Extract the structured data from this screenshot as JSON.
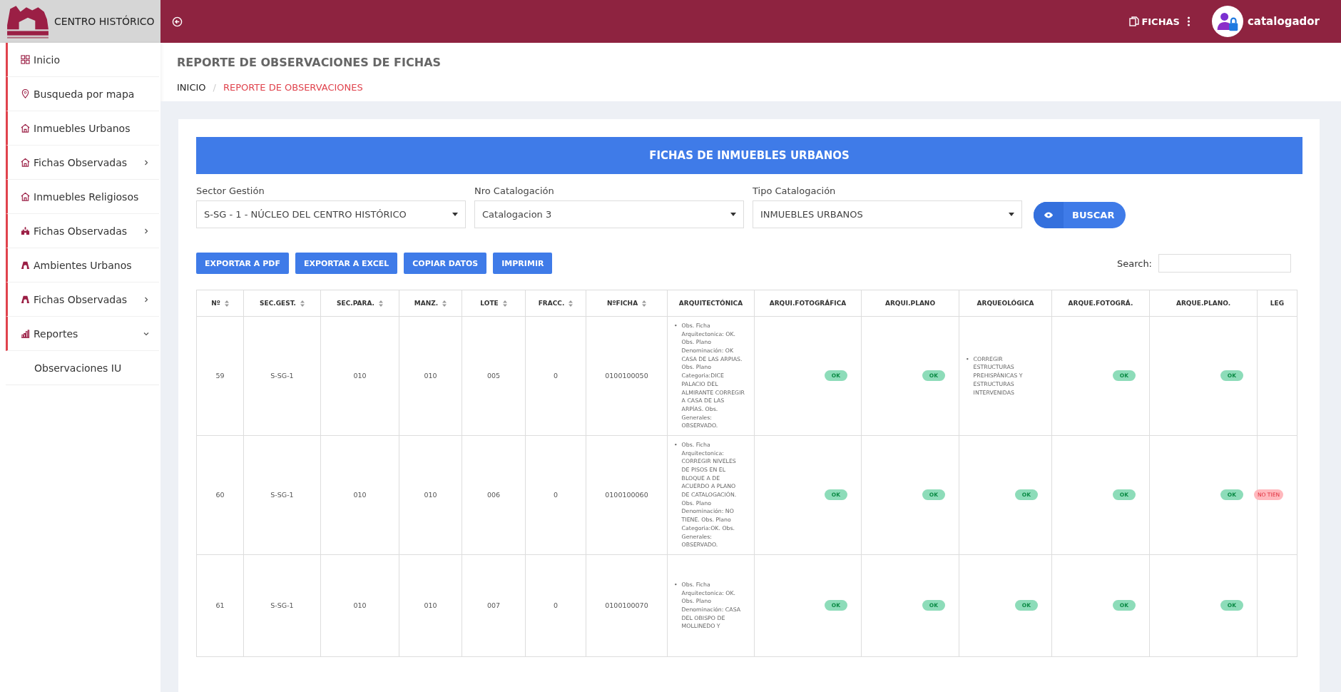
{
  "brand": {
    "title": "CENTRO HISTÓRICO"
  },
  "topbar": {
    "menu_label": "FICHAS",
    "user": "catalogador"
  },
  "sidebar": {
    "items": [
      {
        "kind": "grid",
        "label": "Inicio"
      },
      {
        "kind": "pin",
        "label": "Busqueda por mapa"
      },
      {
        "kind": "house",
        "label": "Inmuebles Urbanos"
      },
      {
        "kind": "house",
        "label": "Fichas Observadas",
        "expanded": false
      },
      {
        "kind": "house",
        "label": "Inmuebles Religiosos"
      },
      {
        "kind": "castle",
        "label": "Fichas Observadas",
        "expanded": false
      },
      {
        "kind": "gate",
        "label": "Ambientes Urbanos"
      },
      {
        "kind": "gate",
        "label": "Fichas Observadas",
        "expanded": false
      },
      {
        "kind": "chart",
        "label": "Reportes",
        "expanded": true,
        "children": [
          {
            "label": "Observaciones IU"
          }
        ]
      }
    ]
  },
  "page": {
    "title": "REPORTE DE OBSERVACIONES DE FICHAS",
    "breadcrumb": [
      "INICIO",
      "REPORTE DE OBSERVACIONES"
    ],
    "breadcrumb_separator": "/"
  },
  "card": {
    "banner": "FICHAS DE INMUEBLES URBANOS",
    "filters": [
      {
        "label": "Sector Gestión",
        "value": "S-SG - 1 - NÚCLEO DEL CENTRO HISTÓRICO"
      },
      {
        "label": "Nro Catalogación",
        "value": "Catalogacion 3"
      },
      {
        "label": "Tipo Catalogación",
        "value": "INMUEBLES URBANOS"
      }
    ],
    "search_button": "BUSCAR",
    "export_buttons": [
      "EXPORTAR A PDF",
      "EXPORTAR A EXCEL",
      "COPIAR DATOS",
      "IMPRIMIR"
    ],
    "search": {
      "label": "Search:"
    },
    "table": {
      "columns": [
        {
          "label": "Nº",
          "sortable": true
        },
        {
          "label": "SEC.GEST.",
          "sortable": true
        },
        {
          "label": "SEC.PARA.",
          "sortable": true
        },
        {
          "label": "MANZ.",
          "sortable": true
        },
        {
          "label": "LOTE",
          "sortable": true
        },
        {
          "label": "FRACC.",
          "sortable": true
        },
        {
          "label": "NºFICHA",
          "sortable": true
        },
        {
          "label": "ARQUITECTÓNICA",
          "sortable": false
        },
        {
          "label": "ARQUI.FOTOGRÁFICA",
          "sortable": false
        },
        {
          "label": "ARQUI.PLANO",
          "sortable": false
        },
        {
          "label": "ARQUEOLÓGICA",
          "sortable": false
        },
        {
          "label": "ARQUE.FOTOGRÁ.",
          "sortable": false
        },
        {
          "label": "ARQUE.PLANO.",
          "sortable": false
        },
        {
          "label": "LEG",
          "sortable": false
        }
      ],
      "rows": [
        {
          "cells": [
            "59",
            "S-SG-1",
            "010",
            "010",
            "005",
            "0",
            "0100100050"
          ],
          "reviews": [
            {
              "kind": "list",
              "marker": "•",
              "items": [
                "Obs. Ficha Arquitectonica: OK. Obs. Plano Denominación: OK CASA DE LAS ARPIAS. Obs. Plano Categoria:DICE PALACIO DEL ALMIRANTE CORREGIR A CASA DE LAS ARPÍAS. Obs. Generales: OBSERVADO."
              ]
            },
            {
              "kind": "ok",
              "text": "OK"
            },
            {
              "kind": "ok",
              "text": "OK"
            },
            {
              "kind": "list",
              "marker": "•",
              "items": [
                "CORREGIR ESTRUCTURAS PREHISPÁNICAS Y ESTRUCTURAS INTERVENIDAS"
              ]
            },
            {
              "kind": "ok",
              "text": "OK"
            },
            {
              "kind": "ok",
              "text": "OK"
            }
          ]
        },
        {
          "cells": [
            "60",
            "S-SG-1",
            "010",
            "010",
            "006",
            "0",
            "0100100060"
          ],
          "reviews": [
            {
              "kind": "list",
              "marker": "•",
              "items": [
                "Obs. Ficha Arquitectonica: CORREGIR NIVELES DE PISOS EN EL BLOQUE A DE ACUERDO A PLANO DE CATALOGACIÓN. Obs. Plano Denominación: NO TIENE. Obs. Plano Categoria:OK. Obs. Generales: OBSERVADO."
              ]
            },
            {
              "kind": "ok",
              "text": "OK"
            },
            {
              "kind": "ok",
              "text": "OK"
            },
            {
              "kind": "ok",
              "text": "OK"
            },
            {
              "kind": "ok",
              "text": "OK"
            },
            {
              "kind": "ok",
              "text": "OK"
            },
            {
              "kind": "missing",
              "text": "NO TIEN"
            }
          ]
        },
        {
          "cells": [
            "61",
            "S-SG-1",
            "010",
            "010",
            "007",
            "0",
            "0100100070"
          ],
          "reviews": [
            {
              "kind": "list",
              "marker": "•",
              "items": [
                "Obs. Ficha Arquitectonica: OK. Obs. Plano Denominación: CASA DEL OBISPO DE MOLLINEDO Y"
              ]
            },
            {
              "kind": "ok",
              "text": "OK"
            },
            {
              "kind": "ok",
              "text": "OK"
            },
            {
              "kind": "ok",
              "text": "OK"
            },
            {
              "kind": "ok",
              "text": "OK"
            },
            {
              "kind": "ok",
              "text": "OK"
            }
          ]
        }
      ]
    }
  }
}
